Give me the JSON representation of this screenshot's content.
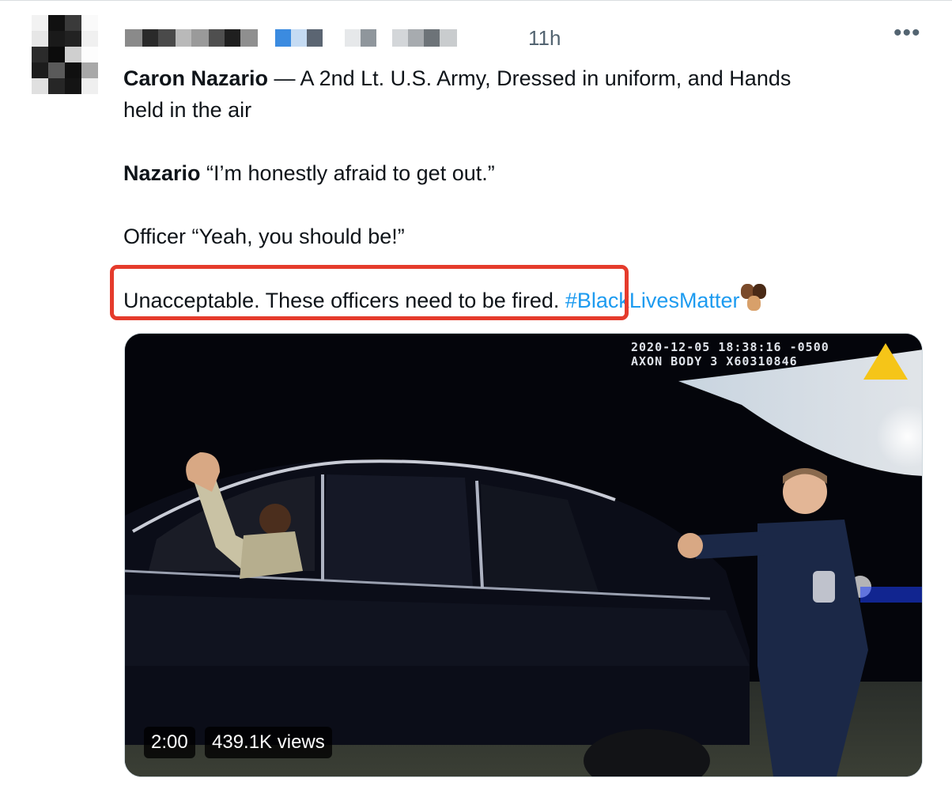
{
  "tweet": {
    "timestamp": "11h",
    "more_icon": "more-horizontal-icon",
    "line1_bold": "Caron Nazario",
    "line1_rest": " — A 2nd Lt. U.S. Army, Dressed in uniform, and Hands",
    "line2": "held in the air",
    "quote_speaker": "Nazario",
    "quote_text": " “I’m honestly afraid to get out.”",
    "officer_line": "Officer “Yeah, you should be!”",
    "closing_text": "Unacceptable. These officers need to be fired.",
    "hashtag": "#BlackLivesMatter",
    "emoji_icon": "raised-fists-emoji-icon"
  },
  "video": {
    "bodycam_line1": "2020-12-05 18:38:16 -0500",
    "bodycam_line2": "AXON BODY 3 X60310846",
    "duration": "2:00",
    "views": "439.1K views"
  },
  "colors": {
    "text": "#0f1419",
    "secondary": "#536471",
    "link": "#1d9bf0",
    "annotation_red": "#e53b2c"
  }
}
